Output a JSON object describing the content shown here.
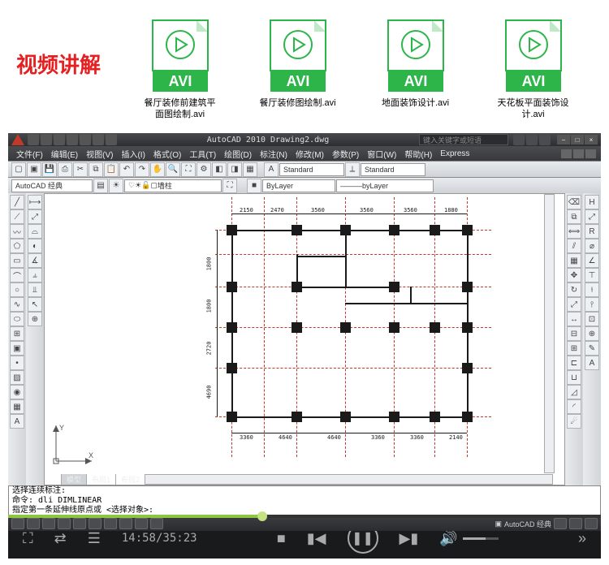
{
  "section_title": "视频讲解",
  "files": [
    {
      "badge": "AVI",
      "name": "餐厅装修前建筑平面图绘制.avi"
    },
    {
      "badge": "AVI",
      "name": "餐厅装修图绘制.avi"
    },
    {
      "badge": "AVI",
      "name": "地面装饰设计.avi"
    },
    {
      "badge": "AVI",
      "name": "天花板平面装饰设计.avi"
    }
  ],
  "acad": {
    "title": "AutoCAD 2010  Drawing2.dwg",
    "search_placeholder": "键入关键字或短语",
    "menus": [
      "文件(F)",
      "编辑(E)",
      "视图(V)",
      "插入(I)",
      "格式(O)",
      "工具(T)",
      "绘图(D)",
      "标注(N)",
      "修改(M)",
      "参数(P)",
      "窗口(W)",
      "帮助(H)",
      "Express"
    ],
    "workspace": "AutoCAD 经典",
    "layer": "墙柱",
    "style1": "Standard",
    "style2": "Standard",
    "linetype": "byLayer",
    "bylayer": "ByLayer",
    "tabs": [
      "模型",
      "布局1",
      "布局2"
    ],
    "cmd1": "选择连续标注:",
    "cmd2": "命令:  dli DIMLINEAR",
    "cmd3": "指定第一条延伸线原点或 <选择对象>:",
    "status_ws": "AutoCAD 经典",
    "dims_top": [
      "2150",
      "2470",
      "3560",
      "3560",
      "3560",
      "1880"
    ],
    "dims_left": [
      "1800",
      "1800",
      "2720",
      "4690"
    ],
    "dims_bottom": [
      "3360",
      "4640",
      "4640",
      "3360",
      "3360",
      "2140"
    ]
  },
  "player": {
    "time": "14:58/35:23",
    "progress_pct": 42
  }
}
